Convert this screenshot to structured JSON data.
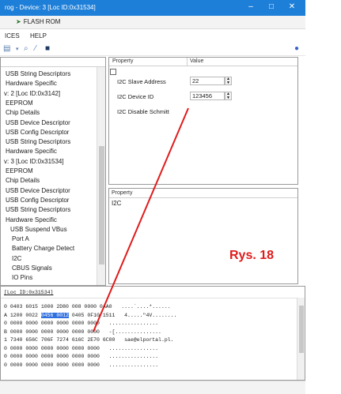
{
  "titlebar": {
    "title": "rog - Device: 3 [Loc ID:0x31534]",
    "minimize": "–",
    "maximize": "□",
    "close": "✕"
  },
  "tab": {
    "label": "FLASH ROM"
  },
  "menu": {
    "items": [
      "ICES",
      "HELP"
    ]
  },
  "toolbar": {
    "icons": [
      "device-icon",
      "search-icon",
      "wand-icon",
      "chip-icon"
    ]
  },
  "tree": {
    "items": [
      "USB String Descriptors",
      "Hardware Specific",
      "v: 2 [Loc ID:0x3142]",
      "EEPROM",
      "Chip Details",
      "USB Device Descriptor",
      "USB Config Descriptor",
      "USB String Descriptors",
      "Hardware Specific",
      "v: 3 [Loc ID:0x31534]",
      "EEPROM",
      "Chip Details",
      "USB Device Descriptor",
      "USB Config Descriptor",
      "USB String Descriptors",
      "Hardware Specific",
      "USB Suspend VBus",
      "Port A",
      "Battery Charge Detect",
      "I2C",
      "CBUS Signals",
      "IO Pins"
    ]
  },
  "properties": {
    "header_property": "Property",
    "header_value": "Value",
    "rows": [
      {
        "label": "I2C Slave Address",
        "value": "22"
      },
      {
        "label": "I2C Device ID",
        "value": "123456"
      },
      {
        "label": "I2C Disable Schmitt",
        "value": ""
      }
    ]
  },
  "description": {
    "header": "Property",
    "text": "I2C"
  },
  "annotation": {
    "label": "Rys. 18",
    "color": "#e01b1b"
  },
  "hex": {
    "header": "[Loc ID:0x31534]",
    "rows": [
      {
        "addr": "0",
        "pre": "0403 6015 1000 2D80 ",
        "hl": "",
        "post": "008 0000 0AA0",
        "ascii": "....`....*......"
      },
      {
        "addr": "A",
        "pre": "1200 0022 ",
        "hl": "0456 0012",
        "post": "0405 0F10 1511",
        "ascii": "4.....\"4V........"
      },
      {
        "addr": "0",
        "pre": "0000 0000 0000 0000 ",
        "hl": "",
        "post": "0000 0000",
        "ascii": "................"
      },
      {
        "addr": "B",
        "pre": "0000 0000 0000 0000 ",
        "hl": "",
        "post": "0000 0000",
        "ascii": "-[..............."
      },
      {
        "addr": "1",
        "pre": "7340 656C 706F 7274 ",
        "hl": "",
        "post": "616C 2E70 6C00",
        "ascii": "sae@elportal.pl."
      },
      {
        "addr": "0",
        "pre": "0000 0000 0000 0000 ",
        "hl": "",
        "post": "0000 0000",
        "ascii": "................"
      },
      {
        "addr": "0",
        "pre": "0000 0000 0000 0000 ",
        "hl": "",
        "post": "0000 0000",
        "ascii": "................"
      },
      {
        "addr": "0",
        "pre": "0000 0000 0000 0000 ",
        "hl": "",
        "post": "0000 0000",
        "ascii": "................"
      }
    ]
  }
}
